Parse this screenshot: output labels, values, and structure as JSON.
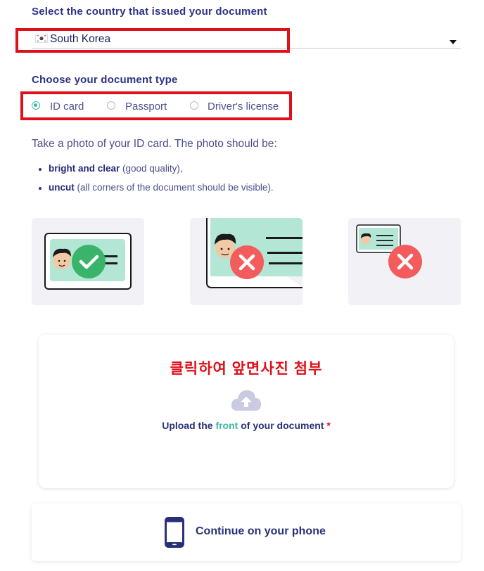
{
  "country_section": {
    "heading": "Select the country that issued your document",
    "selected_country": "South Korea",
    "flag_icon": "south-korea-flag-icon",
    "dropdown_icon": "caret-down-icon"
  },
  "doc_type_section": {
    "heading": "Choose your document type",
    "options": [
      {
        "label": "ID card",
        "selected": true
      },
      {
        "label": "Passport",
        "selected": false
      },
      {
        "label": "Driver's license",
        "selected": false
      }
    ]
  },
  "instructions": {
    "intro": "Take a photo of your ID card. The photo should be:",
    "bullets": [
      {
        "bold": "bright and clear",
        "rest": " (good quality),"
      },
      {
        "bold": "uncut",
        "rest": " (all corners of the document should be visible)."
      }
    ]
  },
  "examples": [
    {
      "icon": "id-card-good-example-icon",
      "status": "check-icon"
    },
    {
      "icon": "id-card-cropped-example-icon",
      "status": "x-icon"
    },
    {
      "icon": "id-card-too-far-example-icon",
      "status": "x-icon"
    }
  ],
  "upload": {
    "annotation": "클릭하여 앞면사진 첨부",
    "prefix": "Upload the ",
    "highlight": "front",
    "suffix": " of your document",
    "required_mark": "*",
    "icon": "cloud-upload-icon"
  },
  "phone_button": {
    "label": "Continue on your phone",
    "icon": "smartphone-icon"
  },
  "colors": {
    "accent": "#3fb9a0",
    "navy": "#2d3287",
    "annotation_red": "#e0101a",
    "error_red": "#f25c5c",
    "success_green": "#3ab46b",
    "card_mint": "#b4e6d6"
  }
}
